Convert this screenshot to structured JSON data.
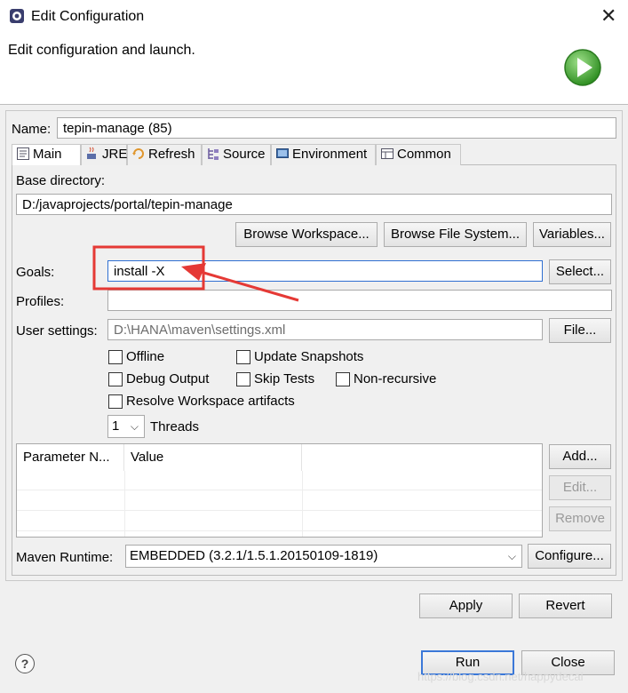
{
  "window": {
    "title": "Edit Configuration",
    "header_message": "Edit configuration and launch."
  },
  "name": {
    "label": "Name:",
    "value": "tepin-manage (85)"
  },
  "tabs": [
    {
      "label": "Main",
      "icon": "main-tab-icon"
    },
    {
      "label": "JRE",
      "icon": "jre-icon"
    },
    {
      "label": "Refresh",
      "icon": "refresh-icon"
    },
    {
      "label": "Source",
      "icon": "source-icon"
    },
    {
      "label": "Environment",
      "icon": "environment-icon"
    },
    {
      "label": "Common",
      "icon": "common-icon"
    }
  ],
  "base_directory": {
    "label": "Base directory:",
    "value": "D:/javaprojects/portal/tepin-manage",
    "buttons": {
      "workspace": "Browse Workspace...",
      "filesystem": "Browse File System...",
      "variables": "Variables..."
    }
  },
  "goals": {
    "label": "Goals:",
    "value": "install -X",
    "button": "Select..."
  },
  "profiles": {
    "label": "Profiles:",
    "value": ""
  },
  "user_settings": {
    "label": "User settings:",
    "value": "D:\\HANA\\maven\\settings.xml",
    "button": "File..."
  },
  "options": {
    "offline": "Offline",
    "update_snapshots": "Update Snapshots",
    "debug_output": "Debug Output",
    "skip_tests": "Skip Tests",
    "non_recursive": "Non-recursive",
    "resolve_workspace": "Resolve Workspace artifacts"
  },
  "threads": {
    "value": "1",
    "label": "Threads"
  },
  "params": {
    "col_name": "Parameter N...",
    "col_value": "Value",
    "add": "Add...",
    "edit": "Edit...",
    "remove": "Remove"
  },
  "runtime": {
    "label": "Maven Runtime:",
    "value": "EMBEDDED (3.2.1/1.5.1.20150109-1819)",
    "configure": "Configure..."
  },
  "actions": {
    "apply": "Apply",
    "revert": "Revert",
    "run": "Run",
    "close": "Close"
  },
  "footer": {
    "help_glyph": "?",
    "watermark": "https://blog.csdn.net/happydecai"
  },
  "colors": {
    "annotation_red": "#e53935",
    "focus_blue": "#2f6fd1",
    "run_green": "#3aa52b"
  }
}
